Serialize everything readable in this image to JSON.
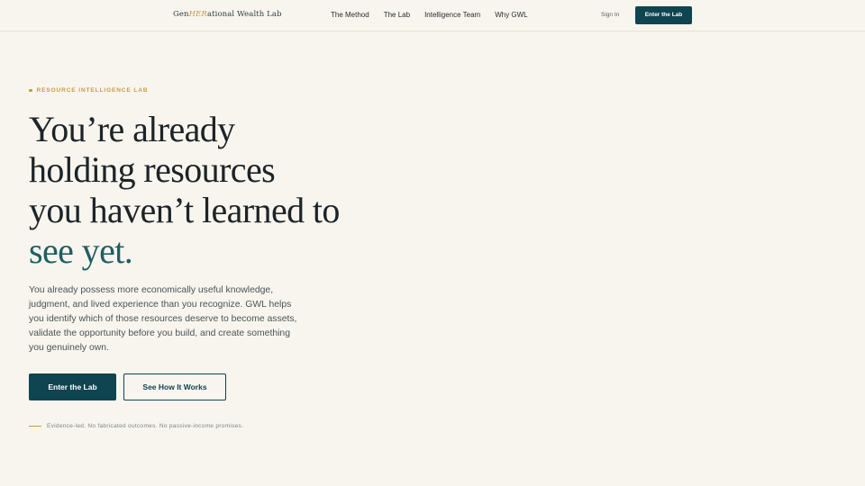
{
  "header": {
    "logo": {
      "pre": "Gen",
      "her": "HER",
      "post": "ational Wealth Lab"
    },
    "nav": [
      "The Method",
      "The Lab",
      "Intelligence Team",
      "Why GWL"
    ],
    "sign_in": "Sign In",
    "cta": "Enter the Lab"
  },
  "hero": {
    "eyebrow": "RESOURCE INTELLIGENCE LAB",
    "headline_lines": [
      "You’re already",
      "holding resources",
      "you haven’t learned to"
    ],
    "headline_accent": "see yet.",
    "body": "You already possess more economically useful knowledge, judgment, and lived experience than you recognize. GWL helps you identify which of those resources deserve to become assets, validate the opportunity before you build, and create something you genuinely own.",
    "primary_cta": "Enter the Lab",
    "secondary_cta": "See How It Works",
    "footnote": "Evidence-led. No fabricated outcomes. No passive-income promises."
  },
  "colors": {
    "background": "#f8f5ee",
    "primary": "#0f4451",
    "accent_gold": "#c79a4a",
    "accent_teal": "#1f5f63"
  }
}
